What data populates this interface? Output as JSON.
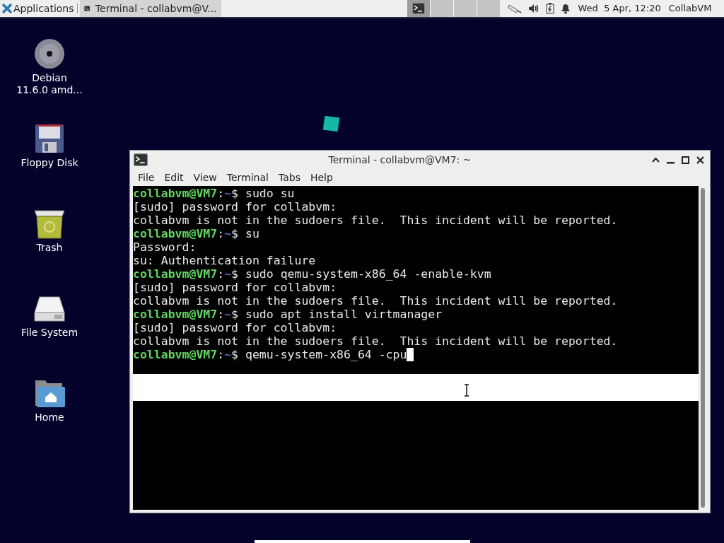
{
  "panel": {
    "applications_label": "Applications",
    "tasks": [
      {
        "title": "Terminal - collabvm@V...",
        "selected": true
      }
    ],
    "workspaces": [
      {
        "has_window": true,
        "selected": true
      },
      {
        "has_window": false,
        "selected": false
      },
      {
        "has_window": false,
        "selected": false
      },
      {
        "has_window": false,
        "selected": false
      }
    ],
    "clock": "Wed  5 Apr, 12:20",
    "user": "CollabVM"
  },
  "desktop_icons": [
    {
      "kind": "disc",
      "label": "Debian\n11.6.0 amd..."
    },
    {
      "kind": "floppy",
      "label": "Floppy Disk"
    },
    {
      "kind": "trash",
      "label": "Trash"
    },
    {
      "kind": "drive",
      "label": "File System"
    },
    {
      "kind": "home",
      "label": "Home"
    }
  ],
  "terminal": {
    "title": "Terminal - collabvm@VM7: ~",
    "menu": [
      "File",
      "Edit",
      "View",
      "Terminal",
      "Tabs",
      "Help"
    ],
    "lines": [
      {
        "kind": "prompt",
        "user": "collabvm@VM7",
        "sep": ":",
        "path": "~",
        "symbol": "$",
        "command": "sudo su"
      },
      {
        "kind": "output",
        "text": "[sudo] password for collabvm:"
      },
      {
        "kind": "output",
        "text": "collabvm is not in the sudoers file.  This incident will be reported."
      },
      {
        "kind": "prompt",
        "user": "collabvm@VM7",
        "sep": ":",
        "path": "~",
        "symbol": "$",
        "command": "su"
      },
      {
        "kind": "output",
        "text": "Password:"
      },
      {
        "kind": "output",
        "text": "su: Authentication failure"
      },
      {
        "kind": "prompt",
        "user": "collabvm@VM7",
        "sep": ":",
        "path": "~",
        "symbol": "$",
        "command": "sudo qemu-system-x86_64 -enable-kvm"
      },
      {
        "kind": "output",
        "text": "[sudo] password for collabvm:"
      },
      {
        "kind": "output",
        "text": "collabvm is not in the sudoers file.  This incident will be reported."
      },
      {
        "kind": "prompt",
        "user": "collabvm@VM7",
        "sep": ":",
        "path": "~",
        "symbol": "$",
        "command": "sudo apt install virtmanager"
      },
      {
        "kind": "output",
        "text": "[sudo] password for collabvm:"
      },
      {
        "kind": "output",
        "text": "collabvm is not in the sudoers file.  This incident will be reported."
      },
      {
        "kind": "prompt",
        "user": "collabvm@VM7",
        "sep": ":",
        "path": "~",
        "symbol": "$",
        "command": "qemu-system-x86_64 -cpu",
        "cursor": true
      }
    ]
  }
}
